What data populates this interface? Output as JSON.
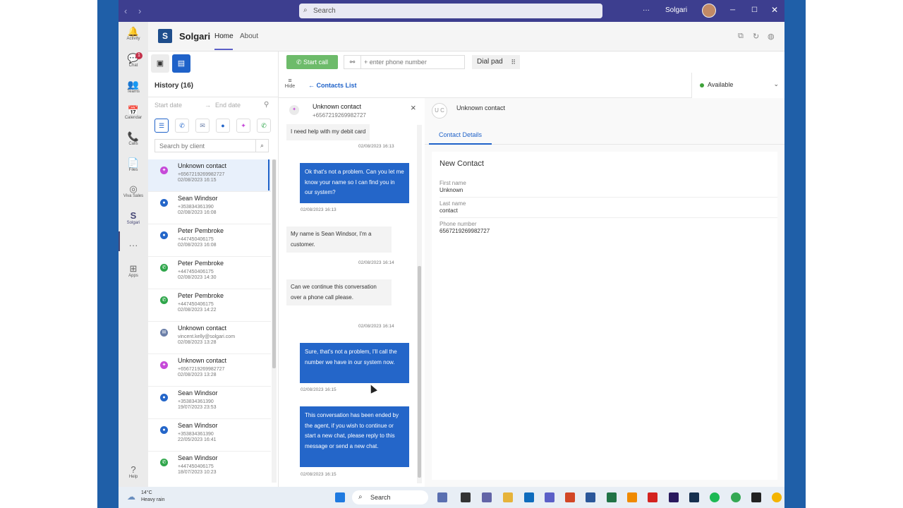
{
  "titlebar": {
    "search_placeholder": "Search",
    "user_name": "Solgari",
    "more": "···"
  },
  "rail": [
    {
      "id": "activity",
      "label": "Activity",
      "glyph": "🔔"
    },
    {
      "id": "chat",
      "label": "Chat",
      "glyph": "💬",
      "badge": "1"
    },
    {
      "id": "teams",
      "label": "Teams",
      "glyph": "👥"
    },
    {
      "id": "calendar",
      "label": "Calendar",
      "glyph": "📅"
    },
    {
      "id": "calls",
      "label": "Calls",
      "glyph": "📞"
    },
    {
      "id": "files",
      "label": "Files",
      "glyph": "📄"
    },
    {
      "id": "viva-sales",
      "label": "Viva Sales",
      "glyph": "◎"
    },
    {
      "id": "solgari",
      "label": "Solgari",
      "glyph": "S"
    },
    {
      "id": "more",
      "label": "",
      "glyph": "···"
    },
    {
      "id": "apps",
      "label": "Apps",
      "glyph": "⊞"
    },
    {
      "id": "help",
      "label": "Help",
      "glyph": "?"
    }
  ],
  "app": {
    "logo": "S",
    "name": "Solgari",
    "tabs": [
      {
        "label": "Home"
      },
      {
        "label": "About"
      }
    ]
  },
  "history": {
    "title": "History (16)",
    "start_date_placeholder": "Start date",
    "end_date_placeholder": "End date",
    "date_arrow": "→",
    "search_placeholder": "Search by client",
    "items": [
      {
        "name": "Unknown contact",
        "sub": "+6567219269982727",
        "date": "02/08/2023 16:15",
        "channel": "messenger",
        "color": "#c64ad8",
        "glyph": "✦"
      },
      {
        "name": "Sean Windsor",
        "sub": "+353834361390",
        "date": "02/08/2023 16:08",
        "channel": "chat",
        "color": "#2466c9",
        "glyph": "●"
      },
      {
        "name": "Peter Pembroke",
        "sub": "+447450406175",
        "date": "02/08/2023 16:08",
        "channel": "chat",
        "color": "#2466c9",
        "glyph": "●"
      },
      {
        "name": "Peter Pembroke",
        "sub": "+447450406175",
        "date": "02/08/2023 14:30",
        "channel": "whatsapp",
        "color": "#2fa64b",
        "glyph": "✆"
      },
      {
        "name": "Peter Pembroke",
        "sub": "+447450406175",
        "date": "02/08/2023 14:22",
        "channel": "whatsapp",
        "color": "#2fa64b",
        "glyph": "✆"
      },
      {
        "name": "Unknown contact",
        "sub": "vincent.kelly@solgari.com",
        "date": "02/08/2023 13:28",
        "channel": "email",
        "color": "#6b7fa8",
        "glyph": "✉"
      },
      {
        "name": "Unknown contact",
        "sub": "+6567219269982727",
        "date": "02/08/2023 13:28",
        "channel": "messenger",
        "color": "#c64ad8",
        "glyph": "✦"
      },
      {
        "name": "Sean Windsor",
        "sub": "+353834361390",
        "date": "19/07/2023 23:53",
        "channel": "chat",
        "color": "#2466c9",
        "glyph": "●"
      },
      {
        "name": "Sean Windsor",
        "sub": "+353834361390",
        "date": "22/05/2023 16:41",
        "channel": "chat",
        "color": "#2466c9",
        "glyph": "●"
      },
      {
        "name": "Sean Windsor",
        "sub": "+447450406175",
        "date": "18/07/2023 10:23",
        "channel": "call",
        "color": "#2fa64b",
        "glyph": "✆"
      }
    ]
  },
  "toolbar": {
    "start_call": "Start call",
    "phone_placeholder": "+ enter phone number",
    "dial_pad": "Dial pad",
    "hide": "Hide",
    "contacts_list": "Contacts List",
    "back_arrow": "←",
    "status": "Available"
  },
  "chat": {
    "contact_name": "Unknown contact",
    "contact_number": "+6567219269982727",
    "close": "×",
    "messages": [
      {
        "dir": "in",
        "text": "I need help with my debit card",
        "time": "02/08/2023 16:13"
      },
      {
        "dir": "out",
        "text": "Ok that's not a problem. Can you let me know your name so I can find you in our system?",
        "time": "02/08/2023 16:13"
      },
      {
        "dir": "in",
        "text": "My name is Sean Windsor, I'm a customer.",
        "time": "02/08/2023 16:14"
      },
      {
        "dir": "in",
        "text": "Can we continue this conversation over a phone call please.",
        "time": "02/08/2023 16:14"
      },
      {
        "dir": "out",
        "text": "Sure, that's not a problem, I'll call the number we have in our system now.",
        "time": "02/08/2023 16:15"
      },
      {
        "dir": "out",
        "text": "This conversation has been ended by the agent, if you wish to continue or start a new chat, please reply to this message or send a new chat.",
        "time": "02/08/2023 16:15"
      }
    ]
  },
  "contact": {
    "initials": "U C",
    "name": "Unknown contact",
    "tab": "Contact Details",
    "card_title": "New Contact",
    "fields": [
      {
        "label": "First name",
        "value": "Unknown"
      },
      {
        "label": "Last name",
        "value": "contact"
      },
      {
        "label": "Phone number",
        "value": "6567219269982727"
      }
    ]
  },
  "taskbar": {
    "temp": "14°C",
    "weather": "Heavy rain",
    "search": "Search"
  }
}
